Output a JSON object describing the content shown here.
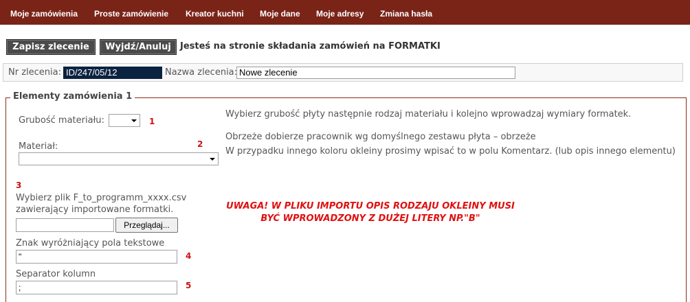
{
  "nav": {
    "items": [
      "Moje zamówienia",
      "Proste zamówienie",
      "Kreator kuchni",
      "Moje dane",
      "Moje adresy",
      "Zmiana hasła"
    ]
  },
  "toolbar": {
    "save_label": "Zapisz zlecenie",
    "exit_label": "Wyjdź/Anuluj",
    "info": "Jesteś na stronie składania zamówień na FORMATKI"
  },
  "order": {
    "nr_label": "Nr zlecenia:",
    "nr_value": "ID/247/05/12",
    "name_label": "Nazwa zlecenia:",
    "name_value": "Nowe zlecenie"
  },
  "section": {
    "legend": "Elementy zamówienia 1",
    "thickness_label": "Grubość materiału:",
    "thickness_value": "",
    "step1": "1",
    "material_label": "Materiał:",
    "material_value": "",
    "step2": "2",
    "step3": "3",
    "file_label_line1": "Wybierz plik F_to_programm_xxxx.csv",
    "file_label_line2": "zawierający importowane formatki.",
    "file_value": "",
    "browse_label": "Przeglądaj...",
    "text_marker_label": "Znak wyróżniający pola tekstowe",
    "text_marker_value": "\"",
    "step4": "4",
    "separator_label": "Separator kolumn",
    "separator_value": ";",
    "step5": "5"
  },
  "help": {
    "line1": "Wybierz grubość płyty następnie rodzaj materiału i kolejno wprowadzaj wymiary formatek.",
    "line2": "Obrzeże dobierze pracownik wg domyślnego zestawu płyta – obrzeże",
    "line3": "W przypadku innego koloru okleiny prosimy wpisać to w polu Komentarz. (lub opis innego elementu)"
  },
  "warning": {
    "line1": "UWAGA! W PLIKU IMPORTU OPIS RODZAJU OKLEINY MUSI",
    "line2": "BYĆ WPROWADZONY Z DUŻEJ LITERY NP.\"B\""
  },
  "colors": {
    "nav_bg": "#7a2418",
    "accent_red": "#e01010",
    "fieldset_border": "#8a2a1a",
    "order_nr_bg": "#0b2340"
  }
}
